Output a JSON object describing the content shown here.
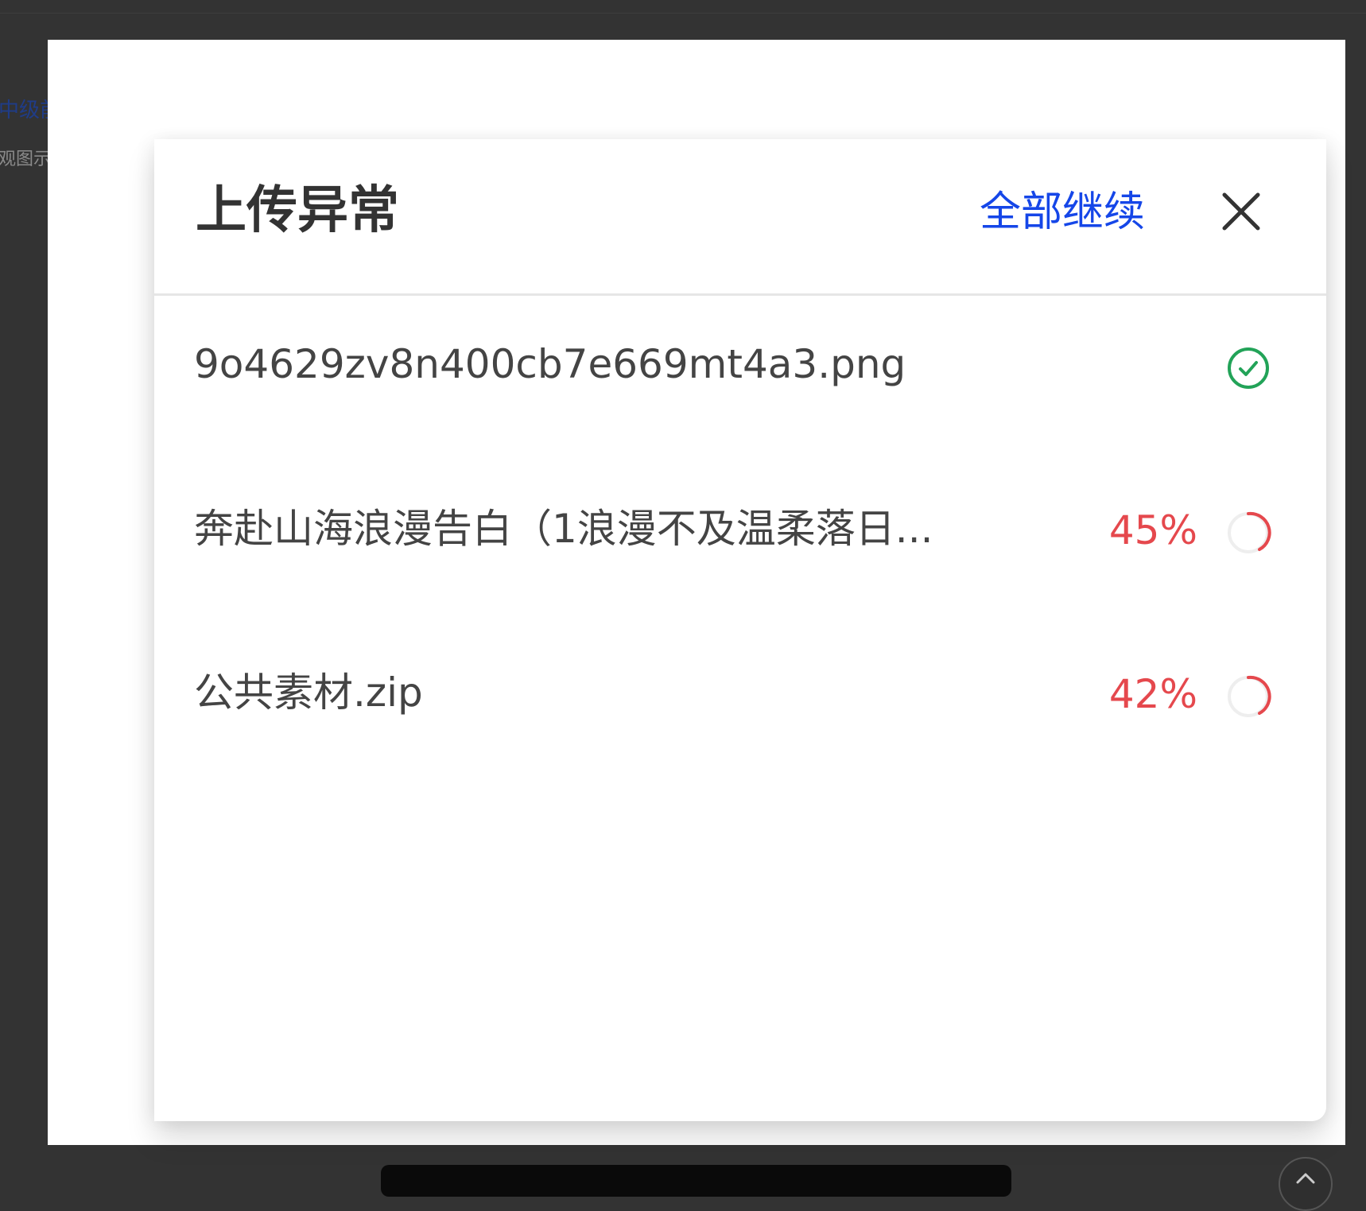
{
  "background": {
    "left_link_fragment": "中级前",
    "left_caption_fragment": "观图示"
  },
  "dialog": {
    "title": "上传异常",
    "continue_all_label": "全部继续",
    "close_icon": "close-icon",
    "files": [
      {
        "name": "9o4629zv8n400cb7e669mt4a3.png",
        "status": "complete",
        "progress_text": "",
        "icon": "check-circle-icon"
      },
      {
        "name": "奔赴山海浪漫告白（1浪漫不及温柔落日...",
        "status": "uploading",
        "progress_text": "45%",
        "progress": 0.45,
        "icon": "loading-spinner-icon"
      },
      {
        "name": "公共素材.zip",
        "status": "uploading",
        "progress_text": "42%",
        "progress": 0.42,
        "icon": "loading-spinner-icon"
      }
    ]
  },
  "colors": {
    "accent_blue": "#1546e8",
    "error_red": "#e5484d",
    "success_green": "#22a358",
    "title_text": "#333333",
    "body_text": "#444444",
    "backdrop_dark": "#333333"
  }
}
